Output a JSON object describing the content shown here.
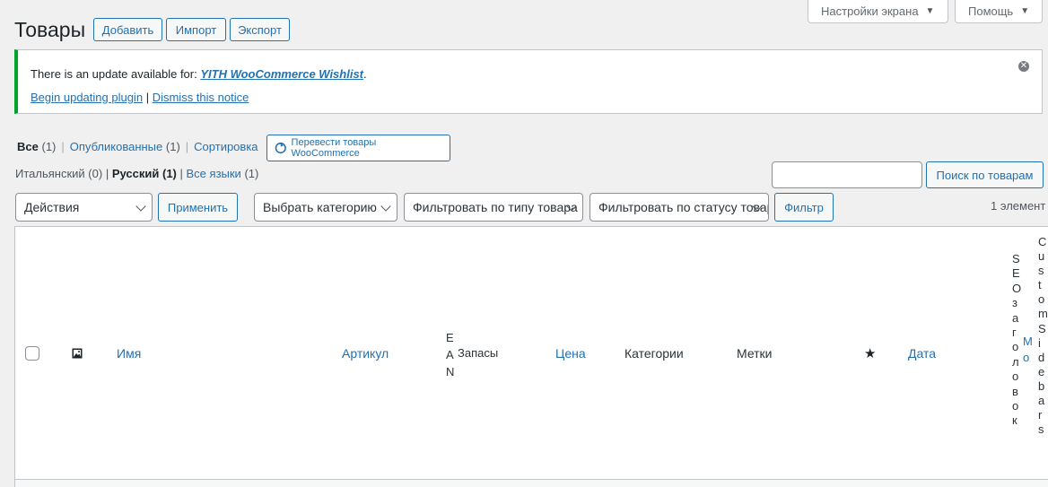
{
  "screen_meta": {
    "screen_options": "Настройки экрана",
    "help": "Помощь"
  },
  "header": {
    "title": "Товары",
    "add": "Добавить",
    "import": "Импорт",
    "export": "Экспорт"
  },
  "notice": {
    "text_before": "There is an update available for: ",
    "plugin_name": "YITH WooCommerce Wishlist",
    "text_after": ".",
    "begin_update": "Begin updating plugin",
    "separator": "|",
    "dismiss": "Dismiss this notice"
  },
  "views": {
    "all_label": "Все",
    "all_count": "(1)",
    "published_label": "Опубликованные",
    "published_count": "(1)",
    "sorting_label": "Сортировка",
    "separator": "|",
    "translate_button": "Перевести товары WooCommerce"
  },
  "languages": {
    "italian": "Итальянский",
    "italian_count": "(0)",
    "russian": "Русский",
    "russian_count": "(1)",
    "all_languages": "Все языки",
    "all_count": "(1)",
    "separator": "|"
  },
  "search": {
    "value": "",
    "button": "Поиск по товарам"
  },
  "tablenav": {
    "bulk_actions": "Действия",
    "apply": "Применить",
    "category": "Выбрать категорию",
    "product_type": "Фильтровать по типу товара",
    "stock_status": "Фильтровать по статусу товара",
    "filter": "Фильтр",
    "items_count": "1 элемент"
  },
  "columns": {
    "name": "Имя",
    "sku": "Артикул",
    "ean": "EAN",
    "stock": "Запасы",
    "price": "Цена",
    "categories": "Категории",
    "tags": "Метки",
    "date": "Дата",
    "seo_title": "SEO заголовок",
    "mo": "Мо",
    "custom_sidebars": "CustomSidebars"
  },
  "icons": {
    "image_column": "image-icon",
    "featured": "star-icon",
    "dismiss": "dismiss-icon",
    "translate": "translate-icon"
  }
}
